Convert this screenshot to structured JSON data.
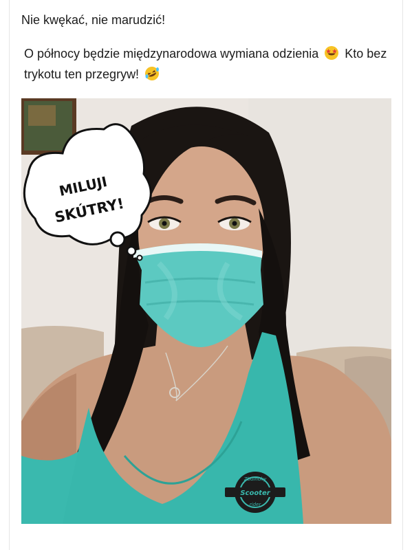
{
  "post": {
    "line1": "Nie kwękać, nie marudzić!",
    "line2_part1": "O północy będzie międzynarodowa wymiana odzienia",
    "line2_part2": "Kto bez trykotu ten przegryw!",
    "emoji1": "star-struck-emoji",
    "emoji2": "rolling-on-floor-laughing-emoji"
  },
  "image": {
    "bubble_line1": "MILUJI",
    "bubble_line2": "SKÚTRY!",
    "logo_top": "Zbulňoky",
    "logo_middle": "Scooter",
    "logo_bottom": "rider"
  },
  "colors": {
    "mask": "#5bc9c2",
    "top": "#3fbfb4",
    "wall": "#ece7e2",
    "hair": "#15110f"
  }
}
